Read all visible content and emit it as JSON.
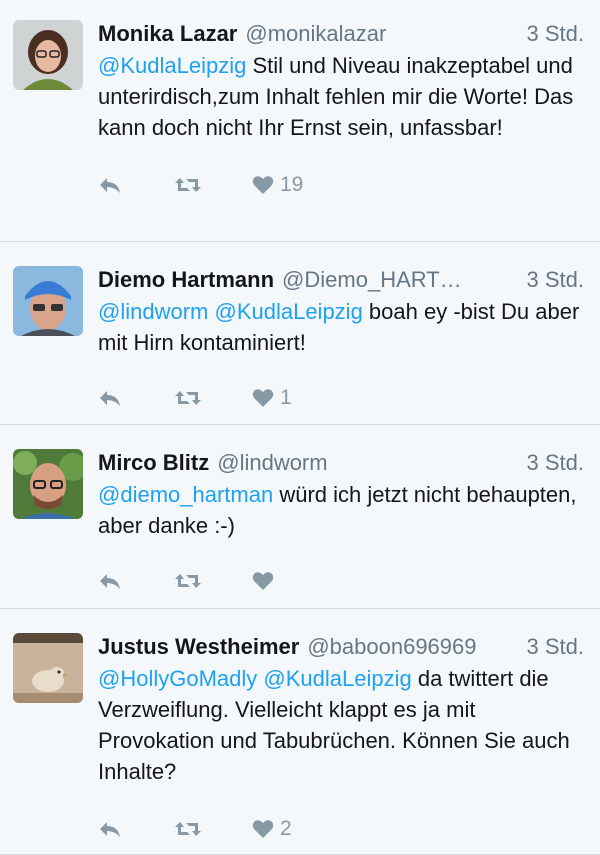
{
  "tweets": [
    {
      "name": "Monika Lazar",
      "handle": "@monikalazar",
      "time": "3 Std.",
      "mentions": [
        "@KudlaLeipzig"
      ],
      "text": " Stil und Niveau inakzeptabel und unterirdisch,zum Inhalt  fehlen mir die Worte! Das kann doch nicht Ihr Ernst sein, unfassbar!",
      "likes": "19"
    },
    {
      "name": "Diemo Hartmann",
      "handle": "@Diemo_HART…",
      "time": "3 Std.",
      "mentions": [
        "@lindworm",
        "@KudlaLeipzig"
      ],
      "text": " boah ey -bist Du aber mit Hirn kontaminiert!",
      "likes": "1"
    },
    {
      "name": "Mirco Blitz",
      "handle": "@lindworm",
      "time": "3 Std.",
      "mentions": [
        "@diemo_hartman"
      ],
      "text": " würd ich jetzt nicht behaupten, aber danke :-)",
      "likes": ""
    },
    {
      "name": "Justus Westheimer",
      "handle": "@baboon696969",
      "time": "3 Std.",
      "mentions": [
        "@HollyGoMadly",
        "@KudlaLeipzig"
      ],
      "text": " da twittert die Verzweiflung. Vielleicht klappt es ja mit Provokation und Tabubrüchen. Können Sie auch Inhalte?",
      "likes": "2"
    }
  ],
  "icons": {
    "reply": "reply-icon",
    "retweet": "retweet-icon",
    "like": "heart-icon"
  },
  "colors": {
    "mention": "#1da1f2",
    "secondary": "#657786",
    "icon": "#8899a6",
    "background": "#f5f8fa"
  }
}
